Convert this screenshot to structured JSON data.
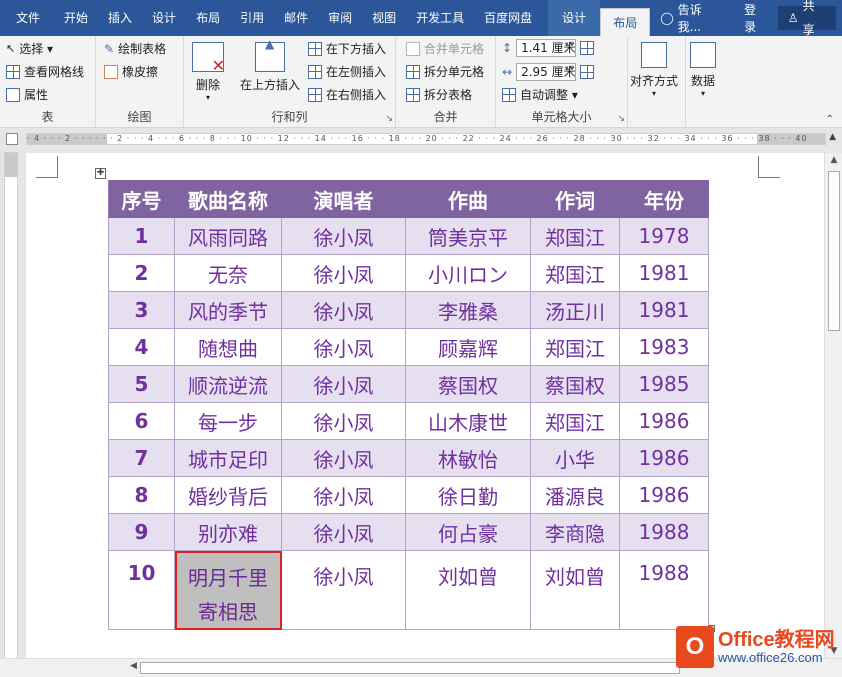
{
  "tabs": {
    "file": "文件",
    "items": [
      "开始",
      "插入",
      "设计",
      "布局",
      "引用",
      "邮件",
      "审阅",
      "视图",
      "开发工具",
      "百度网盘"
    ],
    "ctx_design": "设计",
    "ctx_layout": "布局",
    "tell_me": "告诉我...",
    "login": "登录",
    "share": "共享"
  },
  "ribbon": {
    "table_group": {
      "label": "表",
      "select": "选择 ▾",
      "view_gridlines": "查看网格线",
      "properties": "属性"
    },
    "draw_group": {
      "label": "绘图",
      "draw_table": "绘制表格",
      "eraser": "橡皮擦"
    },
    "rows_cols_group": {
      "label": "行和列",
      "delete": "删除",
      "insert_above": "在上方插入",
      "insert_below": "在下方插入",
      "insert_left": "在左侧插入",
      "insert_right": "在右侧插入"
    },
    "merge_group": {
      "label": "合并",
      "merge_cells": "合并单元格",
      "split_cells": "拆分单元格",
      "split_table": "拆分表格"
    },
    "cell_size_group": {
      "label": "单元格大小",
      "height": "1.41 厘米",
      "width": "2.95 厘米",
      "autofit": "自动调整 ▾"
    },
    "align_group": {
      "label": "对齐方式",
      "align": "对齐方式"
    },
    "data_group": {
      "label": "数据",
      "data": "数据"
    }
  },
  "ruler": {
    "text": "· 4 · · · 2 · · · · · · 2 · · · 4 · · · 6 · · · 8 · · · 10 · · · 12 · · · 14 · · · 16 · · · 18 · · · 20 · · · 22 · · · 24 · · · 26 · · · 28 · · · 30 · · · 32 · · · 34 · · · 36 · · · 38 · · · 40"
  },
  "table": {
    "headers": [
      "序号",
      "歌曲名称",
      "演唱者",
      "作曲",
      "作词",
      "年份"
    ],
    "rows": [
      [
        "1",
        "风雨同路",
        "徐小凤",
        "筒美京平",
        "郑国江",
        "1978"
      ],
      [
        "2",
        "无奈",
        "徐小凤",
        "小川ロン",
        "郑国江",
        "1981"
      ],
      [
        "3",
        "风的季节",
        "徐小凤",
        "李雅桑",
        "汤正川",
        "1981"
      ],
      [
        "4",
        "随想曲",
        "徐小凤",
        "顾嘉辉",
        "郑国江",
        "1983"
      ],
      [
        "5",
        "顺流逆流",
        "徐小凤",
        "蔡国权",
        "蔡国权",
        "1985"
      ],
      [
        "6",
        "每一步",
        "徐小凤",
        "山木康世",
        "郑国江",
        "1986"
      ],
      [
        "7",
        "城市足印",
        "徐小凤",
        "林敏怡",
        "小华",
        "1986"
      ],
      [
        "8",
        "婚纱背后",
        "徐小凤",
        "徐日勤",
        "潘源良",
        "1986"
      ],
      [
        "9",
        "别亦难",
        "徐小凤",
        "何占豪",
        "李商隐",
        "1988"
      ]
    ],
    "last_row": {
      "num": "10",
      "song_line1": "明月千里",
      "song_line2": "寄相思",
      "singer": "徐小凤",
      "composer": "刘如曾",
      "lyricist": "刘如曾",
      "year": "1988"
    }
  },
  "watermark": {
    "title": "Office教程网",
    "url": "www.office26.com",
    "icon_letter": "O"
  },
  "colors": {
    "accent": "#2b579a",
    "header": "#8064a2",
    "stripe": "#e5dfef",
    "text": "#7030a0",
    "selection_border": "#e02020"
  }
}
